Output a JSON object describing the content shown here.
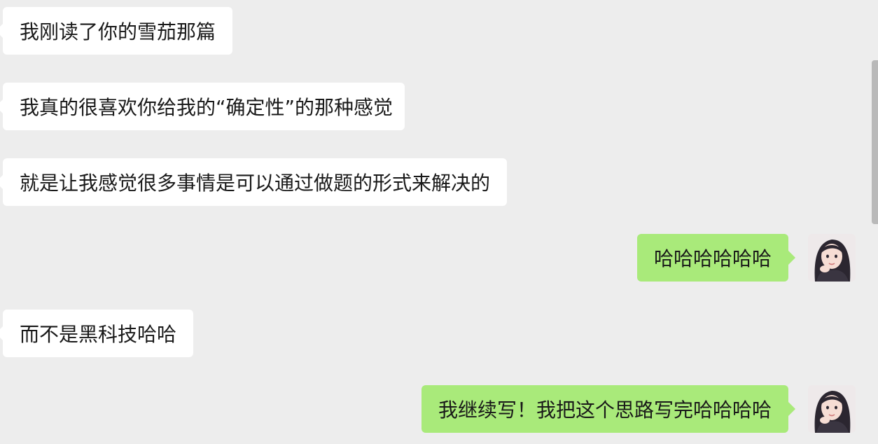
{
  "messages": [
    {
      "side": "left",
      "text": "我刚读了你的雪茄那篇"
    },
    {
      "side": "left",
      "text": "我真的很喜欢你给我的“确定性”的那种感觉"
    },
    {
      "side": "left",
      "text": "就是让我感觉很多事情是可以通过做题的形式来解决的"
    },
    {
      "side": "right",
      "text": "哈哈哈哈哈哈"
    },
    {
      "side": "left",
      "text": "而不是黑科技哈哈"
    },
    {
      "side": "right",
      "text": "我继续写！我把这个思路写完哈哈哈哈"
    }
  ],
  "colors": {
    "background": "#ededed",
    "incoming_bubble": "#ffffff",
    "outgoing_bubble": "#a9ea7a",
    "text": "#191919"
  },
  "icons": {
    "avatar": "user-avatar-photo"
  }
}
